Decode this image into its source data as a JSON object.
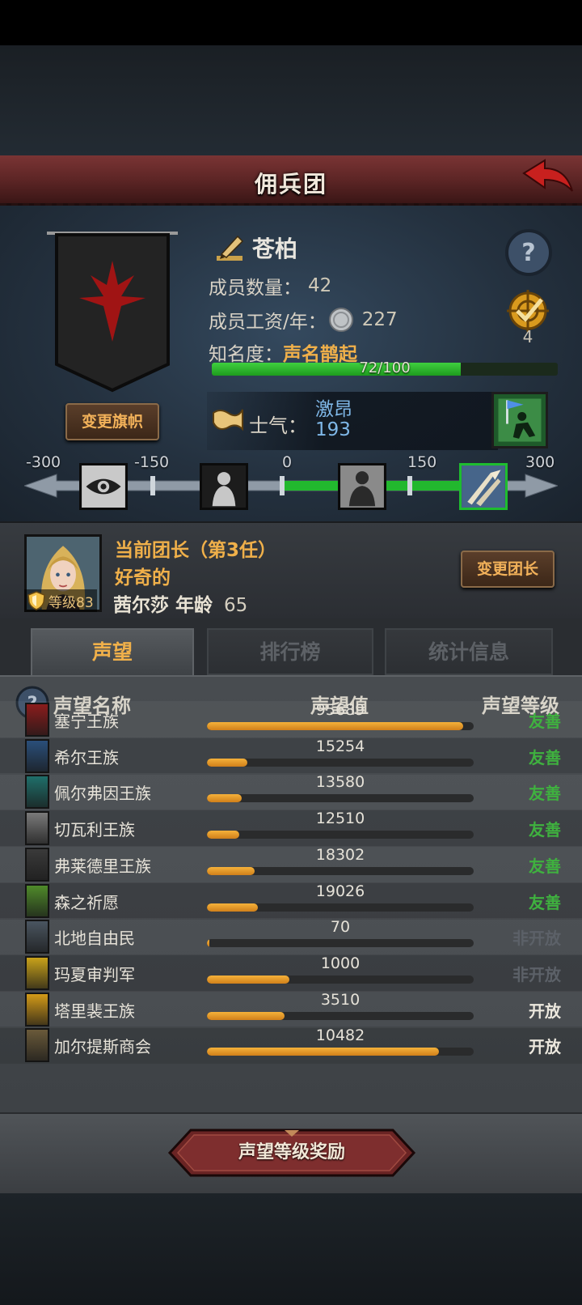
{
  "header": {
    "title": "佣兵团"
  },
  "guild": {
    "name": "苍柏",
    "members_label": "成员数量：",
    "members_value": "42",
    "wage_label": "成员工资/年：",
    "wage_value": "227",
    "fame_label": "知名度：",
    "fame_value": "声名鹊起",
    "fame_progress_text": "72/100",
    "fame_progress": 0.72,
    "target_count": "4",
    "change_flag_label": "变更旗帜"
  },
  "morale": {
    "label": "士气：",
    "state": "激昂",
    "value": "193",
    "ticks": [
      "-300",
      "-150",
      "0",
      "150",
      "300"
    ]
  },
  "leader": {
    "title": "当前团长（第3任）",
    "trait": "好奇的",
    "name": "茜尔莎",
    "age_label": "年龄",
    "age_value": "65",
    "level_text": "等级83",
    "change_leader_label": "变更团长"
  },
  "tabs": [
    {
      "label": "声望",
      "active": true
    },
    {
      "label": "排行榜",
      "active": false
    },
    {
      "label": "统计信息",
      "active": false
    }
  ],
  "reputation": {
    "header_name": "声望名称",
    "header_value": "声望值",
    "header_level": "声望等级",
    "rows": [
      {
        "name": "塞宁王族",
        "value": "95689",
        "progress": 0.96,
        "level": "友善",
        "level_type": "friendly",
        "icon_color": "#8a1c1c"
      },
      {
        "name": "希尔王族",
        "value": "15254",
        "progress": 0.15,
        "level": "友善",
        "level_type": "friendly",
        "icon_color": "#2a4f7a"
      },
      {
        "name": "佩尔弗因王族",
        "value": "13580",
        "progress": 0.13,
        "level": "友善",
        "level_type": "friendly",
        "icon_color": "#1f6f6a"
      },
      {
        "name": "切瓦利王族",
        "value": "12510",
        "progress": 0.12,
        "level": "友善",
        "level_type": "friendly",
        "icon_color": "#7a7a7a"
      },
      {
        "name": "弗莱德里王族",
        "value": "18302",
        "progress": 0.18,
        "level": "友善",
        "level_type": "friendly",
        "icon_color": "#3a3a3a"
      },
      {
        "name": "森之祈愿",
        "value": "19026",
        "progress": 0.19,
        "level": "友善",
        "level_type": "friendly",
        "icon_color": "#4f8a2a"
      },
      {
        "name": "北地自由民",
        "value": "70",
        "progress": 0.01,
        "level": "非开放",
        "level_type": "closed",
        "icon_color": "#4a5560"
      },
      {
        "name": "玛夏审判军",
        "value": "1000",
        "progress": 0.31,
        "level": "非开放",
        "level_type": "closed",
        "icon_color": "#c9a21a"
      },
      {
        "name": "塔里裴王族",
        "value": "3510",
        "progress": 0.29,
        "level": "开放",
        "level_type": "open",
        "icon_color": "#d39a18"
      },
      {
        "name": "加尔提斯商会",
        "value": "10482",
        "progress": 0.87,
        "level": "开放",
        "level_type": "open",
        "icon_color": "#6a5a3a"
      }
    ]
  },
  "reward_button": {
    "label": "声望等级奖励"
  }
}
